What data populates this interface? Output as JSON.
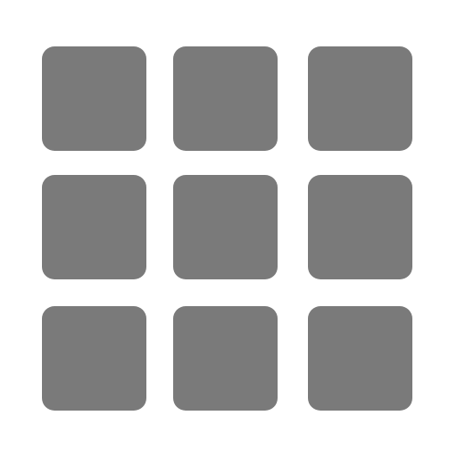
{
  "icon": {
    "name": "grid-icon",
    "rows": 3,
    "columns": 3,
    "fill_color": "#7a7a7a",
    "background_color": "#ffffff"
  }
}
